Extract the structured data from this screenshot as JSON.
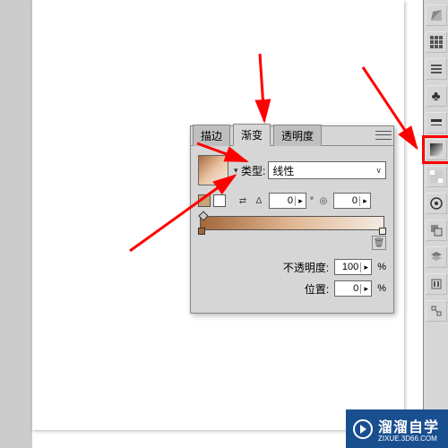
{
  "sidebar": {
    "items": [
      {
        "name": "color-icon"
      },
      {
        "name": "swatches-icon"
      },
      {
        "name": "brushes-icon"
      },
      {
        "name": "symbols-icon"
      },
      {
        "name": "stroke-icon"
      },
      {
        "name": "gradient-icon"
      },
      {
        "name": "transparency-icon"
      },
      {
        "name": "appearance-icon"
      },
      {
        "name": "graphic-styles-icon"
      },
      {
        "name": "layers-icon"
      },
      {
        "name": "actions-icon"
      },
      {
        "name": "links-icon"
      }
    ]
  },
  "panel": {
    "tabs": [
      {
        "label": "描边",
        "active": false
      },
      {
        "label": "渐变",
        "active": true
      },
      {
        "label": "透明度",
        "active": false
      }
    ],
    "type_label": "类型:",
    "type_value": "线性",
    "angle_label": "Δ",
    "angle_value": "0",
    "aspect_value": "0",
    "opacity_label": "不透明度:",
    "opacity_value": "100",
    "position_label": "位置:",
    "position_value": "0",
    "pct": "%",
    "gradient": {
      "stops_top": [
        0
      ],
      "stops_bottom": [
        0,
        100
      ]
    }
  },
  "watermark": {
    "text": "溜溜自学",
    "sub": "ZIXUE.3D66.COM"
  },
  "annotations": {
    "arrows_color": "#ff0000"
  },
  "chart_data": null
}
